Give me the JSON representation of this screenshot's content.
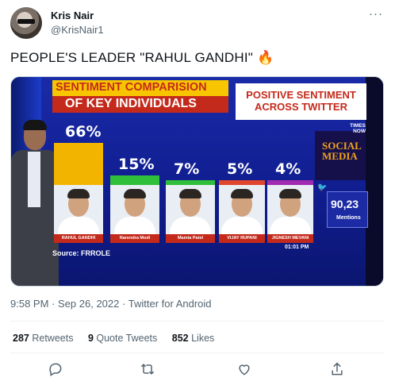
{
  "author": {
    "name": "Kris Nair",
    "handle": "@KrisNair1"
  },
  "more_icon": "more-horizontal-icon",
  "tweet": {
    "text": "PEOPLE'S LEADER \"RAHUL GANDHI\"",
    "emoji": "🔥"
  },
  "media": {
    "sentiment_title_line1": "SENTIMENT COMPARISION",
    "sentiment_title_line2": "OF KEY INDIVIDUALS",
    "positive_line1": "POSITIVE SENTIMENT",
    "positive_line2": "ACROSS TWITTER",
    "source": "Source: FRROLE",
    "clock": "01:01 PM",
    "channel_top": "TIMES",
    "channel_bottom": "NOW",
    "social_word": "SOCIAL MEDIA",
    "mentions_value": "90,23",
    "mentions_label": "Mentions",
    "candidates": [
      {
        "percent": "66%",
        "name": "RAHUL GANDHI",
        "value": 66,
        "bar_color": "#f3b400"
      },
      {
        "percent": "15%",
        "name": "Narendra Modi",
        "value": 15,
        "bar_color": "#2fbf3a"
      },
      {
        "percent": "7%",
        "name": "Mamta Patel",
        "value": 7,
        "bar_color": "#2fbf3a"
      },
      {
        "percent": "5%",
        "name": "VIJAY RUPANI",
        "value": 5,
        "bar_color": "#e0452d"
      },
      {
        "percent": "4%",
        "name": "JIGNESH MEVANI",
        "value": 4,
        "bar_color": "#a02ab0"
      }
    ]
  },
  "meta": {
    "time": "9:58 PM",
    "separator": "·",
    "date": "Sep 26, 2022",
    "client": "Twitter for Android"
  },
  "stats": {
    "retweets_count": "287",
    "retweets_label": "Retweets",
    "quotes_count": "9",
    "quotes_label": "Quote Tweets",
    "likes_count": "852",
    "likes_label": "Likes"
  },
  "actions": [
    "reply-icon",
    "retweet-icon",
    "like-icon",
    "share-icon"
  ]
}
